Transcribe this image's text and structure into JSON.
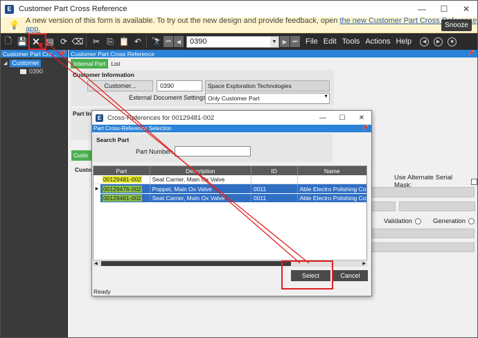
{
  "window": {
    "title": "Customer Part Cross Reference",
    "logo": "E",
    "minimize": "—",
    "maximize": "☐",
    "close": "✕"
  },
  "banner": {
    "text": "A new version of this form is available. To try out the new design and provide feedback, open",
    "link": "the new Customer Part Cross Reference app.",
    "snooze": "Snooze",
    "icon": "lightbulb-icon"
  },
  "toolbar": {
    "combo_value": "0390",
    "menus": [
      "File",
      "Edit",
      "Tools",
      "Actions",
      "Help"
    ]
  },
  "tree": {
    "header": "Customer Part Cro...",
    "root": "Customer",
    "child": "0390"
  },
  "main": {
    "header": "Customer Part Cross Reference",
    "tabs": [
      "Internal Part",
      "List"
    ],
    "customer_info_label": "Customer Information",
    "customer_button": "Customer...",
    "customer_id": "0390",
    "customer_name": "Space Exploration Technologies",
    "ext_doc_label": "External Document Settings:",
    "ext_doc_value": "Only Customer Part",
    "part_info_label": "Part Info",
    "green_tab": "Custo",
    "custo_label": "Custor",
    "alt_serial_label": "Use Alternate Serial Mask:",
    "validation_label": "Validation",
    "generation_label": "Generation"
  },
  "dialog": {
    "title": "Cross-References for 00129481-002",
    "logo": "E",
    "section_header": "Part Cross-Reference Selection",
    "search_label": "Search Part",
    "part_number_label": "Part Number:",
    "part_number_value": "",
    "columns": [
      "Part",
      "Description",
      "ID",
      "Name"
    ],
    "rows": [
      {
        "part": "00129481-002",
        "description": "Seat Carrier, Main Ox Valve",
        "id": "",
        "name": "",
        "selected": false
      },
      {
        "part": "00129476-002",
        "description": "Poppet, Main Ox Valve",
        "id": "0011",
        "name": "Able Electro Polishing Co.",
        "selected": true
      },
      {
        "part": "00129481-002",
        "description": "Seat Carrier, Main Ox Valve",
        "id": "0011",
        "name": "Able Electro Polishing Co.",
        "selected": true
      }
    ],
    "select_button": "Select",
    "cancel_button": "Cancel",
    "status": "Ready"
  },
  "colors": {
    "accent": "#2a83d8",
    "tab_green": "#4caf50",
    "selection_blue": "#2f6fc4",
    "annotation_red": "#e02020"
  }
}
